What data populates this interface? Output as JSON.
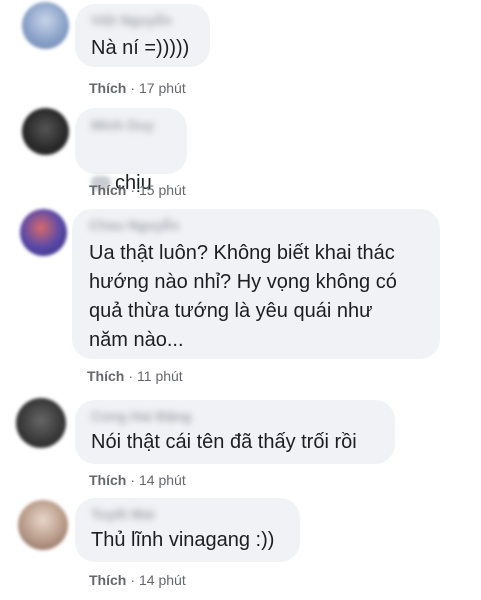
{
  "comments": [
    {
      "author": "Việt Nguyễn",
      "text": "Nà ní =)))))",
      "like_label": "Thích",
      "separator": "·",
      "time": "17 phút",
      "avatar_color": "#8aa2c8"
    },
    {
      "author": "Minh Duy",
      "text": "chịu",
      "like_label": "Thích",
      "separator": "·",
      "time": "15 phút",
      "avatar_color": "#2b2b2b"
    },
    {
      "author": "Chau Nguyễn",
      "text": "Ua thật luôn? Không biết khai thác\nhướng nào nhỉ? Hy vọng không có\nquả thừa tướng là yêu quái như\nnăm nào...",
      "like_label": "Thích",
      "separator": "·",
      "time": "11 phút",
      "avatar_color": "#5c4aa8"
    },
    {
      "author": "Cong Hai Đặng",
      "text": "Nói thật cái tên đã thấy trối rồi",
      "like_label": "Thích",
      "separator": "·",
      "time": "14 phút",
      "avatar_color": "#3a3a3a"
    },
    {
      "author": "Tuyết Mai",
      "text": "Thủ lĩnh vinagang :))",
      "like_label": "Thích",
      "separator": "·",
      "time": "14 phút",
      "avatar_color": "#b89a88"
    }
  ]
}
